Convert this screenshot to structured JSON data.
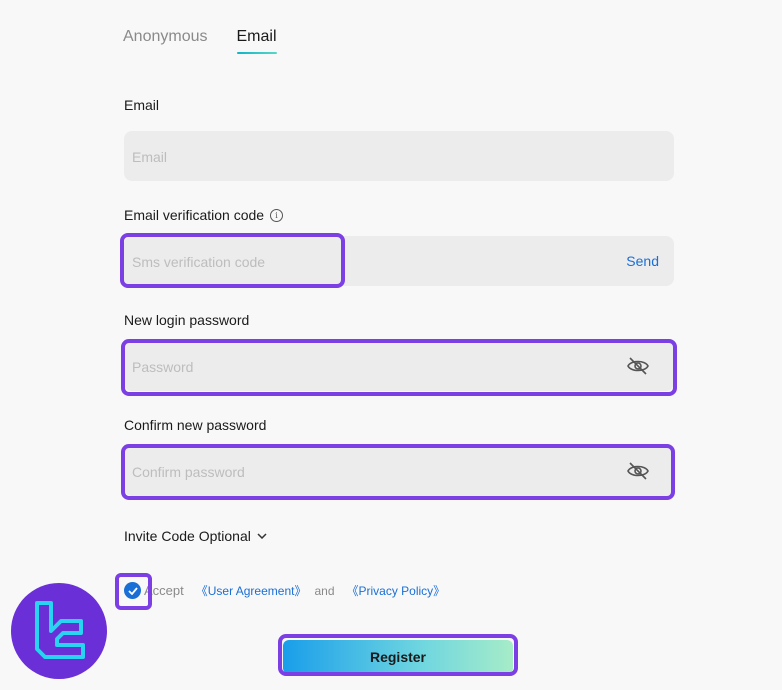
{
  "tabs": [
    {
      "label": "Anonymous",
      "active": false
    },
    {
      "label": "Email",
      "active": true
    }
  ],
  "email": {
    "label": "Email",
    "placeholder": "Email"
  },
  "verification": {
    "label": "Email verification code",
    "placeholder": "Sms verification code",
    "send_label": "Send"
  },
  "new_password": {
    "label": "New login password",
    "placeholder": "Password"
  },
  "confirm_password": {
    "label": "Confirm new password",
    "placeholder": "Confirm password"
  },
  "invite": {
    "label": "Invite Code Optional"
  },
  "agreement": {
    "checked": true,
    "accept_label": "Accept",
    "user_agreement": "《User Agreement》",
    "and_label": "and",
    "privacy_policy": "《Privacy Policy》"
  },
  "register_label": "Register",
  "colors": {
    "accent": "#1a6fd6",
    "highlight": "#7b3fe4",
    "logo_bg": "#6a2fd6",
    "logo_fg": "#29d4f0"
  },
  "icons": {
    "info": "info-icon",
    "eye_off": "eye-off-icon",
    "chevron": "chevron-down-icon",
    "check": "check-icon"
  }
}
